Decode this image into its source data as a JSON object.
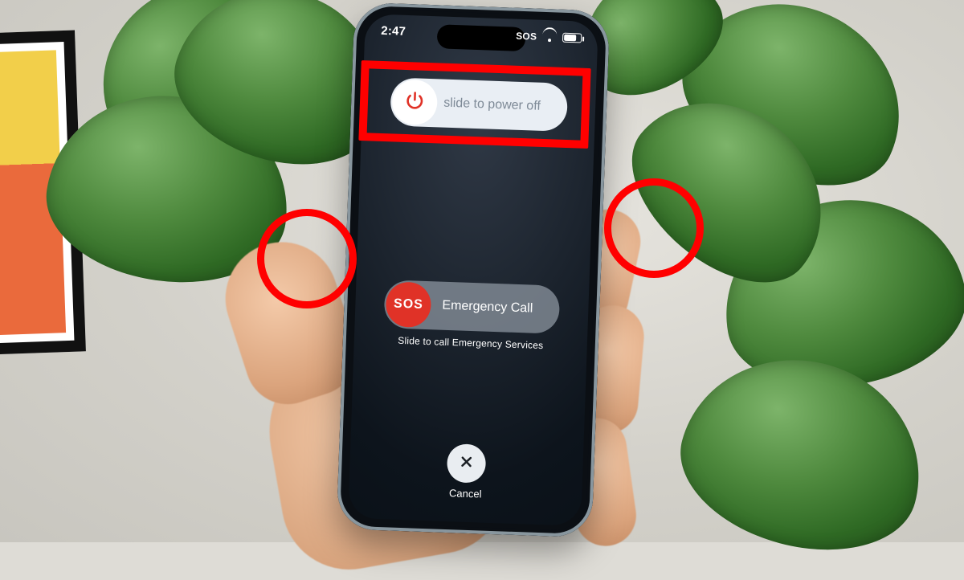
{
  "status_bar": {
    "time": "2:47",
    "sos_label": "SOS"
  },
  "power_slider": {
    "label": "slide to power off"
  },
  "emergency_slider": {
    "badge": "SOS",
    "label": "Emergency Call",
    "hint": "Slide to call Emergency Services"
  },
  "cancel": {
    "label": "Cancel"
  },
  "annotations": {
    "highlight_color": "#ff0000"
  }
}
